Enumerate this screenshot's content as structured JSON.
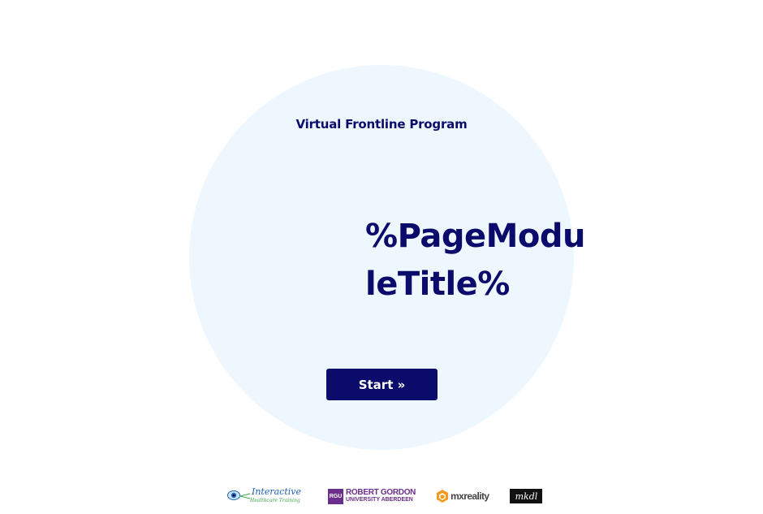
{
  "header": {
    "program_title": "Virtual Frontline Program"
  },
  "main": {
    "module_title": "%PageModuleTitle%",
    "start_label": "Start »"
  },
  "footer": {
    "logos": [
      {
        "icon": "interactive-healthcare-training-logo",
        "line1": "Interactive",
        "line2": "Healthcare Training"
      },
      {
        "icon": "robert-gordon-university-logo",
        "badge": "RGU",
        "line1": "ROBERT GORDON",
        "line2": "UNIVERSITY ABERDEEN"
      },
      {
        "icon": "mxreality-logo",
        "text": "mxreality"
      },
      {
        "icon": "mkdl-logo",
        "text": "mkdl"
      }
    ]
  },
  "colors": {
    "primary": "#0b0b6b",
    "circle_bg": "#eef7fe",
    "rgu_purple": "#6b2e8a"
  }
}
